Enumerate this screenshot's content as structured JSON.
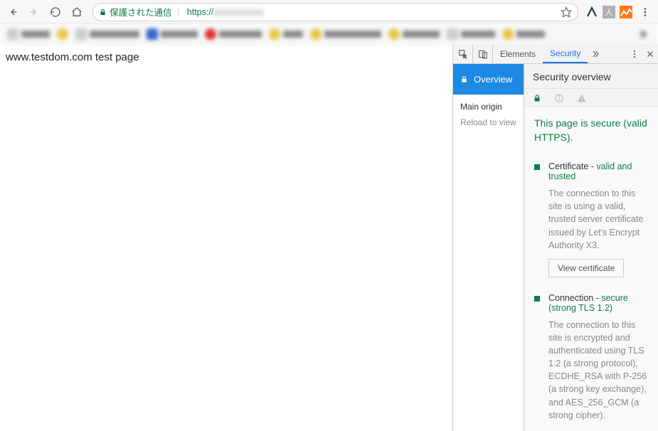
{
  "browser": {
    "secure_label": "保護された通信",
    "url_protocol": "https://",
    "url_rest": "",
    "page_content": "www.testdom.com test page"
  },
  "devtools": {
    "tabs": {
      "elements": "Elements",
      "security": "Security"
    },
    "left": {
      "overview": "Overview",
      "main_origin": "Main origin",
      "reload_hint": "Reload to view"
    },
    "panel": {
      "title": "Security overview",
      "secure_headline": "This page is secure (valid HTTPS).",
      "cert": {
        "label": "Certificate - ",
        "status": "valid and trusted",
        "desc": "The connection to this site is using a valid, trusted server certificate issued by Let's Encrypt Authority X3.",
        "button": "View certificate"
      },
      "conn": {
        "label": "Connection - ",
        "status": "secure (strong TLS 1.2)",
        "desc": "The connection to this site is encrypted and authenticated using TLS 1.2 (a strong protocol), ECDHE_RSA with P-256 (a strong key exchange), and AES_256_GCM (a strong cipher)."
      }
    }
  }
}
